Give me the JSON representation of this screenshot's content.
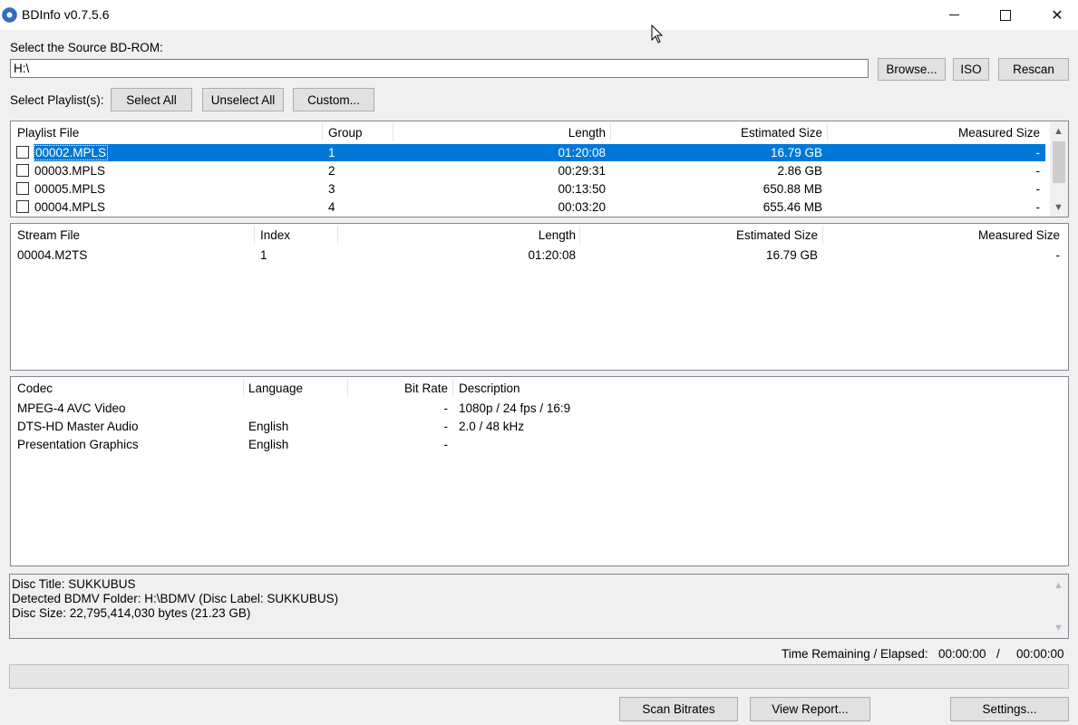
{
  "window": {
    "title": "BDInfo v0.7.5.6"
  },
  "source": {
    "label": "Select the Source BD-ROM:",
    "path": "H:\\",
    "browse": "Browse...",
    "iso": "ISO",
    "rescan": "Rescan"
  },
  "playlist_select": {
    "label": "Select Playlist(s):",
    "select_all": "Select All",
    "unselect_all": "Unselect All",
    "custom": "Custom..."
  },
  "playlists": {
    "columns": [
      "Playlist File",
      "Group",
      "Length",
      "Estimated Size",
      "Measured Size"
    ],
    "rows": [
      {
        "file": "00002.MPLS",
        "group": "1",
        "length": "01:20:08",
        "est": "16.79 GB",
        "meas": "-",
        "selected": true
      },
      {
        "file": "00003.MPLS",
        "group": "2",
        "length": "00:29:31",
        "est": "2.86 GB",
        "meas": "-"
      },
      {
        "file": "00005.MPLS",
        "group": "3",
        "length": "00:13:50",
        "est": "650.88 MB",
        "meas": "-"
      },
      {
        "file": "00004.MPLS",
        "group": "4",
        "length": "00:03:20",
        "est": "655.46 MB",
        "meas": "-"
      }
    ]
  },
  "streams": {
    "columns": [
      "Stream File",
      "Index",
      "Length",
      "Estimated Size",
      "Measured Size"
    ],
    "rows": [
      {
        "file": "00004.M2TS",
        "index": "1",
        "length": "01:20:08",
        "est": "16.79 GB",
        "meas": "-"
      }
    ]
  },
  "codecs": {
    "columns": [
      "Codec",
      "Language",
      "Bit Rate",
      "Description"
    ],
    "rows": [
      {
        "codec": "MPEG-4 AVC Video",
        "lang": "",
        "bitrate": "-",
        "desc": "1080p / 24 fps / 16:9"
      },
      {
        "codec": "DTS-HD Master Audio",
        "lang": "English",
        "bitrate": "-",
        "desc": "2.0 / 48 kHz"
      },
      {
        "codec": "Presentation Graphics",
        "lang": "English",
        "bitrate": "-",
        "desc": ""
      }
    ]
  },
  "info": {
    "lines": [
      "Disc Title: SUKKUBUS",
      "Detected BDMV Folder: H:\\BDMV (Disc Label: SUKKUBUS)",
      "Disc Size: 22,795,414,030 bytes (21.23 GB)"
    ]
  },
  "status": {
    "time_label": "Time Remaining / Elapsed:",
    "remaining": "00:00:00",
    "slash": "/",
    "elapsed": "00:00:00"
  },
  "footer": {
    "scan": "Scan Bitrates",
    "report": "View Report...",
    "settings": "Settings..."
  }
}
